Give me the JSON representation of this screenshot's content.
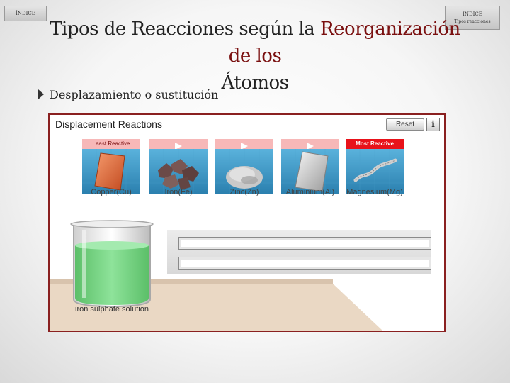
{
  "nav": {
    "left_label": "ÍNDICE",
    "right_label": "ÍNDICE",
    "right_sublabel": "Tipos reacciones"
  },
  "slide": {
    "title_part1": "Tipos de Reacciones según la ",
    "title_highlight": "Reorganización de los",
    "title_part2": "Átomos",
    "bullet": "Desplazamiento o sustitución"
  },
  "simulation": {
    "title": "Displacement Reactions",
    "reset_label": "Reset",
    "info_label": "i",
    "least_reactive_label": "Least Reactive",
    "most_reactive_label": "Most Reactive",
    "metals": [
      {
        "label": "Copper(Cu)",
        "color": "#e06a3c"
      },
      {
        "label": "Iron(Fe)",
        "color": "#6b4a48"
      },
      {
        "label": "Zinc(Zn)",
        "color": "#bdbdbd"
      },
      {
        "label": "Aluminium(Al)",
        "color": "#cfcfcf"
      },
      {
        "label": "Magnesium(Mg)",
        "color": "#a9a9a9"
      }
    ],
    "solution_label": "iron sulphate solution",
    "colors": {
      "border": "#8a2020",
      "tile_header": "#f7b8b8",
      "most_reactive_header": "#e8121a",
      "tile_bg": "#3f9ac4",
      "solution": "#6fcf7a"
    }
  }
}
